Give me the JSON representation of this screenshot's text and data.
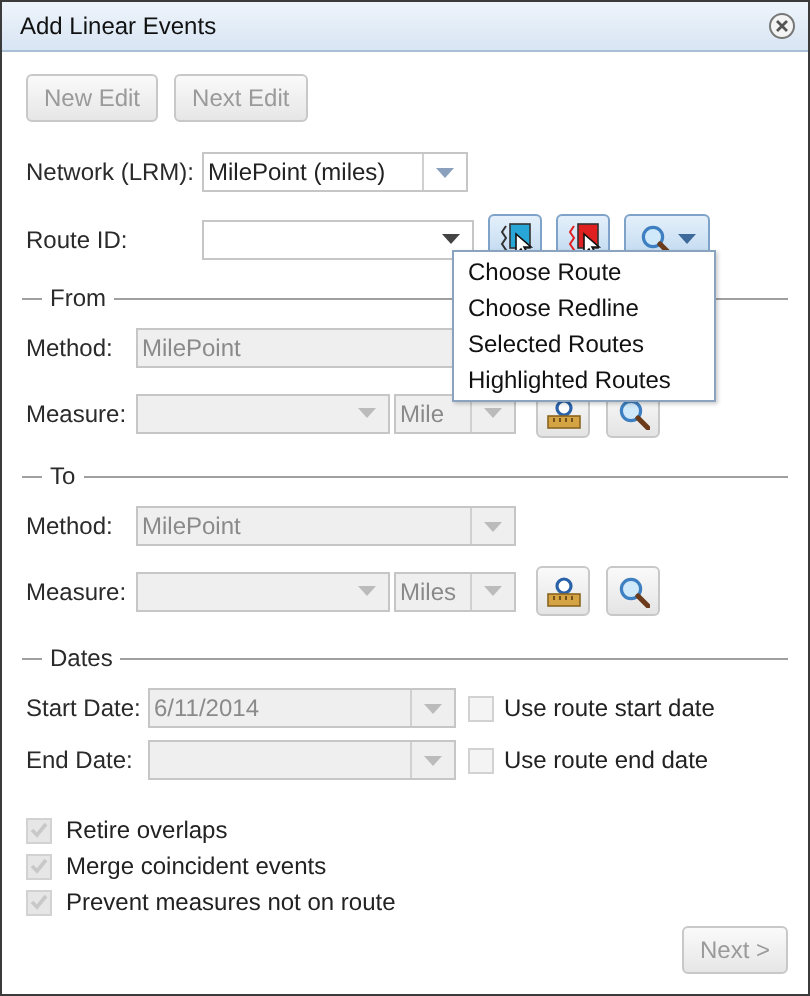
{
  "window": {
    "title": "Add Linear Events"
  },
  "edit_buttons": [
    {
      "label": "New Edit",
      "disabled": true
    },
    {
      "label": "Next Edit",
      "disabled": true
    }
  ],
  "network": {
    "label": "Network (LRM):",
    "value": "MilePoint (miles)",
    "disabled": false
  },
  "route": {
    "label": "Route ID:"
  },
  "route_menu": {
    "items": [
      "Choose Route",
      "Choose Redline",
      "Selected Routes",
      "Highlighted Routes"
    ]
  },
  "measure_sections": [
    {
      "title": "From",
      "method_label": "Method:",
      "method": "MilePoint",
      "measure_label": "Measure:",
      "units": "Mile",
      "disabled": true
    },
    {
      "title": "To",
      "method_label": "Method:",
      "method": "MilePoint",
      "measure_label": "Measure:",
      "units": "Miles",
      "disabled": true
    }
  ],
  "dates": {
    "title": "Dates",
    "rows": [
      {
        "label": "Start Date:",
        "value": "6/11/2014",
        "option": "Use route start date",
        "checked": false
      },
      {
        "label": "End Date:",
        "option": "Use route end date",
        "checked": false
      }
    ]
  },
  "options": [
    {
      "label": "Retire overlaps",
      "checked": true,
      "disabled": true
    },
    {
      "label": "Merge coincident events",
      "checked": true,
      "disabled": true
    },
    {
      "label": "Prevent measures not on route",
      "checked": true,
      "disabled": true
    }
  ],
  "next_button": {
    "label": "Next >",
    "disabled": true
  }
}
